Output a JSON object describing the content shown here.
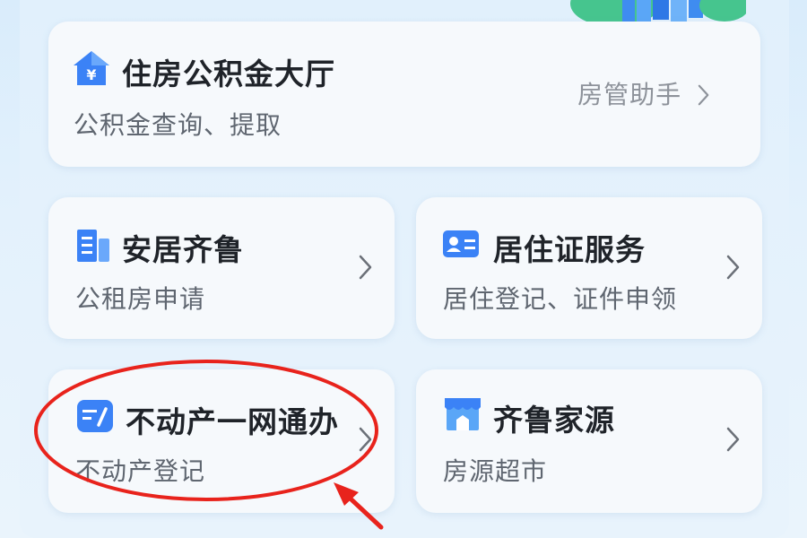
{
  "cards": {
    "housing_fund": {
      "title": "住房公积金大厅",
      "subtitle": "公积金查询、提取",
      "link_label": "房管助手",
      "icon": "yuan-house-icon"
    },
    "anju_qilu": {
      "title": "安居齐鲁",
      "subtitle": "公租房申请",
      "icon": "building-icon"
    },
    "residence_permit": {
      "title": "居住证服务",
      "subtitle": "居住登记、证件申领",
      "icon": "id-card-icon"
    },
    "real_estate": {
      "title": "不动产一网通办",
      "subtitle": "不动产登记",
      "icon": "edit-document-icon"
    },
    "qilu_homes": {
      "title": "齐鲁家源",
      "subtitle": "房源超市",
      "icon": "storefront-icon"
    }
  },
  "colors": {
    "icon_blue": "#3b82f6",
    "annotation_red": "#e8231c"
  }
}
